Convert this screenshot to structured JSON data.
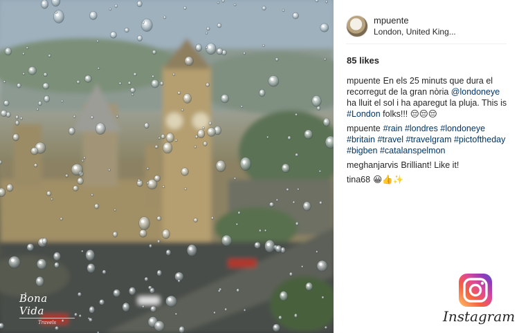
{
  "post": {
    "username": "mpuente",
    "location": "London, United King...",
    "likes_count": "85",
    "likes_label": "likes"
  },
  "photo": {
    "watermark_main": "Bona Vida",
    "watermark_sub": "Travels"
  },
  "comments": [
    {
      "author": "mpuente",
      "parts": [
        {
          "text": "En els 25 minuts que dura el recorregut de la gran nòria ",
          "tag": false
        },
        {
          "text": "@londoneye",
          "tag": true
        },
        {
          "text": " ha lluit el sol i ha aparegut la pluja. This is ",
          "tag": false
        },
        {
          "text": "#London",
          "tag": true
        },
        {
          "text": " folks!!! 😔😔😔",
          "tag": false
        }
      ]
    },
    {
      "author": "mpuente",
      "parts": [
        {
          "text": "#rain",
          "tag": true
        },
        {
          "text": " ",
          "tag": false
        },
        {
          "text": "#londres",
          "tag": true
        },
        {
          "text": " ",
          "tag": false
        },
        {
          "text": "#londoneye",
          "tag": true
        },
        {
          "text": " ",
          "tag": false
        },
        {
          "text": "#britain",
          "tag": true
        },
        {
          "text": " ",
          "tag": false
        },
        {
          "text": "#travel",
          "tag": true
        },
        {
          "text": " ",
          "tag": false
        },
        {
          "text": "#travelgram",
          "tag": true
        },
        {
          "text": " ",
          "tag": false
        },
        {
          "text": "#pictoftheday",
          "tag": true
        },
        {
          "text": " ",
          "tag": false
        },
        {
          "text": "#bigben",
          "tag": true
        },
        {
          "text": " ",
          "tag": false
        },
        {
          "text": "#catalanspelmon",
          "tag": true
        }
      ]
    },
    {
      "author": "meghanjarvis",
      "parts": [
        {
          "text": "Brilliant! Like it!",
          "tag": false
        }
      ]
    },
    {
      "author": "tina68",
      "parts": [
        {
          "text": "😀👍✨",
          "tag": false
        }
      ]
    }
  ],
  "brand": {
    "wordmark": "Instagram",
    "icon": "instagram-logo-icon"
  },
  "colors": {
    "hashtag": "#003569",
    "text": "#262626",
    "logo_gradient": [
      "#fdc468",
      "#df4996",
      "#8a3ab9",
      "#4c68d7"
    ]
  }
}
